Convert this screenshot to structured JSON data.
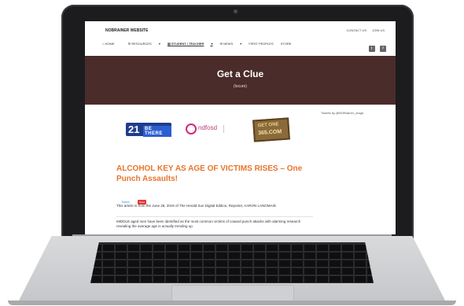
{
  "site": {
    "name": "NOBRAINER WEBSITE",
    "top_links": [
      "CONTACT US",
      "JOIN US"
    ],
    "nav": [
      "HOME",
      "RESOURCES",
      "STUDENT / TEACHER",
      "NEWS",
      "FIRST PEOPLES",
      "STORE"
    ],
    "social": [
      "twitter-icon",
      "facebook-icon"
    ]
  },
  "hero": {
    "title": "Get a Clue",
    "subtitle": "(locure)"
  },
  "sidebar": {
    "twitter_link": "Tweets by @NOBrainer_drugs"
  },
  "logos": {
    "logo1_number": "21",
    "logo1_text": "BE THERE",
    "logo2_text": "ndfosd",
    "logo3_line1": "GET ONE",
    "logo3_line2": "365.COM"
  },
  "article": {
    "title": "ALCOHOL KEY AS AGE OF VICTIMS RISES – One Punch Assaults!",
    "tweet": "Tweet",
    "save": "Save",
    "para1": "This article is from the June 28, 2019 of The Herald Sun Digital Edition, Reporter, AARON LANGMAID",
    "para2": "MIDDLE aged men have been identified as the most common victims of coward punch attacks with alarming research revealing the average age is actually trending up."
  }
}
